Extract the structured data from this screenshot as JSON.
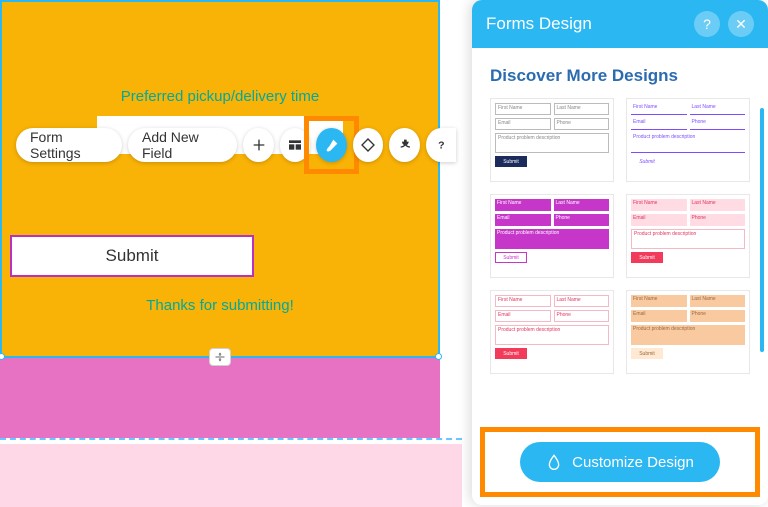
{
  "panel": {
    "title": "Forms Design",
    "subtitle": "Discover More Designs",
    "customize_label": "Customize Design"
  },
  "toolbar": {
    "settings_label": "Form Settings",
    "add_field_label": "Add New Field"
  },
  "form": {
    "field_label": "Preferred pickup/delivery time",
    "submit_label": "Submit",
    "thanks_label": "Thanks for submitting!"
  },
  "design_thumb": {
    "first": "First Name",
    "last": "Last Name",
    "email": "Email",
    "phone": "Phone",
    "desc": "Product problem description",
    "submit": "Submit"
  }
}
